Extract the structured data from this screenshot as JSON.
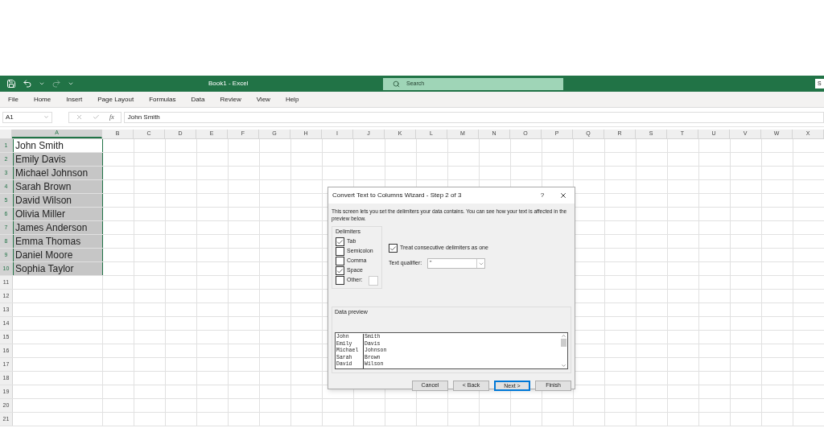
{
  "title_bar": {
    "title": "Book1  -  Excel",
    "search": {
      "placeholder": "Search"
    },
    "account_button": "S"
  },
  "menu": [
    {
      "label": "File"
    },
    {
      "label": "Home"
    },
    {
      "label": "Insert"
    },
    {
      "label": "Page Layout"
    },
    {
      "label": "Formulas"
    },
    {
      "label": "Data"
    },
    {
      "label": "Review"
    },
    {
      "label": "View"
    },
    {
      "label": "Help"
    }
  ],
  "formula_bar": {
    "name_box": "A1",
    "fx": "fx",
    "value": "John Smith"
  },
  "sheet": {
    "columns": [
      "A",
      "B",
      "C",
      "D",
      "E",
      "F",
      "G",
      "H",
      "I",
      "J",
      "K",
      "L",
      "M",
      "N",
      "O",
      "P",
      "Q",
      "R",
      "S",
      "T",
      "U",
      "V",
      "W",
      "X"
    ],
    "rows": [
      "1",
      "2",
      "3",
      "4",
      "5",
      "6",
      "7",
      "8",
      "9",
      "10",
      "11",
      "12",
      "13",
      "14",
      "15",
      "16",
      "17",
      "18",
      "19",
      "20",
      "21"
    ],
    "column_a": [
      {
        "value": "John Smith",
        "selected": true,
        "active": true
      },
      {
        "value": "Emily Davis",
        "selected": true,
        "active": false
      },
      {
        "value": "Michael Johnson",
        "selected": true,
        "active": false
      },
      {
        "value": "Sarah Brown",
        "selected": true,
        "active": false
      },
      {
        "value": "David Wilson",
        "selected": true,
        "active": false
      },
      {
        "value": "Olivia Miller",
        "selected": true,
        "active": false
      },
      {
        "value": "James Anderson",
        "selected": true,
        "active": false
      },
      {
        "value": "Emma Thomas",
        "selected": true,
        "active": false
      },
      {
        "value": "Daniel Moore",
        "selected": true,
        "active": false
      },
      {
        "value": "Sophia Taylor",
        "selected": true,
        "active": false
      }
    ]
  },
  "dialog": {
    "title": "Convert Text to Columns Wizard - Step 2 of 3",
    "help": "?",
    "description": "This screen lets you set the delimiters your data contains.  You can see how your text is affected in the preview below.",
    "delimiters_label": "Delimiters",
    "delimiters": [
      {
        "label": "Tab",
        "checked": true
      },
      {
        "label": "Semicolon",
        "checked": false
      },
      {
        "label": "Comma",
        "checked": false
      },
      {
        "label": "Space",
        "checked": true
      },
      {
        "label": "Other:",
        "checked": false
      }
    ],
    "treat_consecutive": {
      "label": "Treat consecutive delimiters as one",
      "checked": true
    },
    "text_qualifier": {
      "label": "Text qualifier:",
      "value": "\""
    },
    "preview_label": "Data preview",
    "preview": [
      [
        "John",
        "Smith"
      ],
      [
        "Emily",
        "Davis"
      ],
      [
        "Michael",
        "Johnson"
      ],
      [
        "Sarah",
        "Brown"
      ],
      [
        "David",
        "Wilson"
      ]
    ],
    "buttons": [
      {
        "label": "Cancel",
        "default": false
      },
      {
        "label": "< Back",
        "default": false
      },
      {
        "label": "Next >",
        "default": true
      },
      {
        "label": "Finish",
        "default": false
      }
    ]
  }
}
